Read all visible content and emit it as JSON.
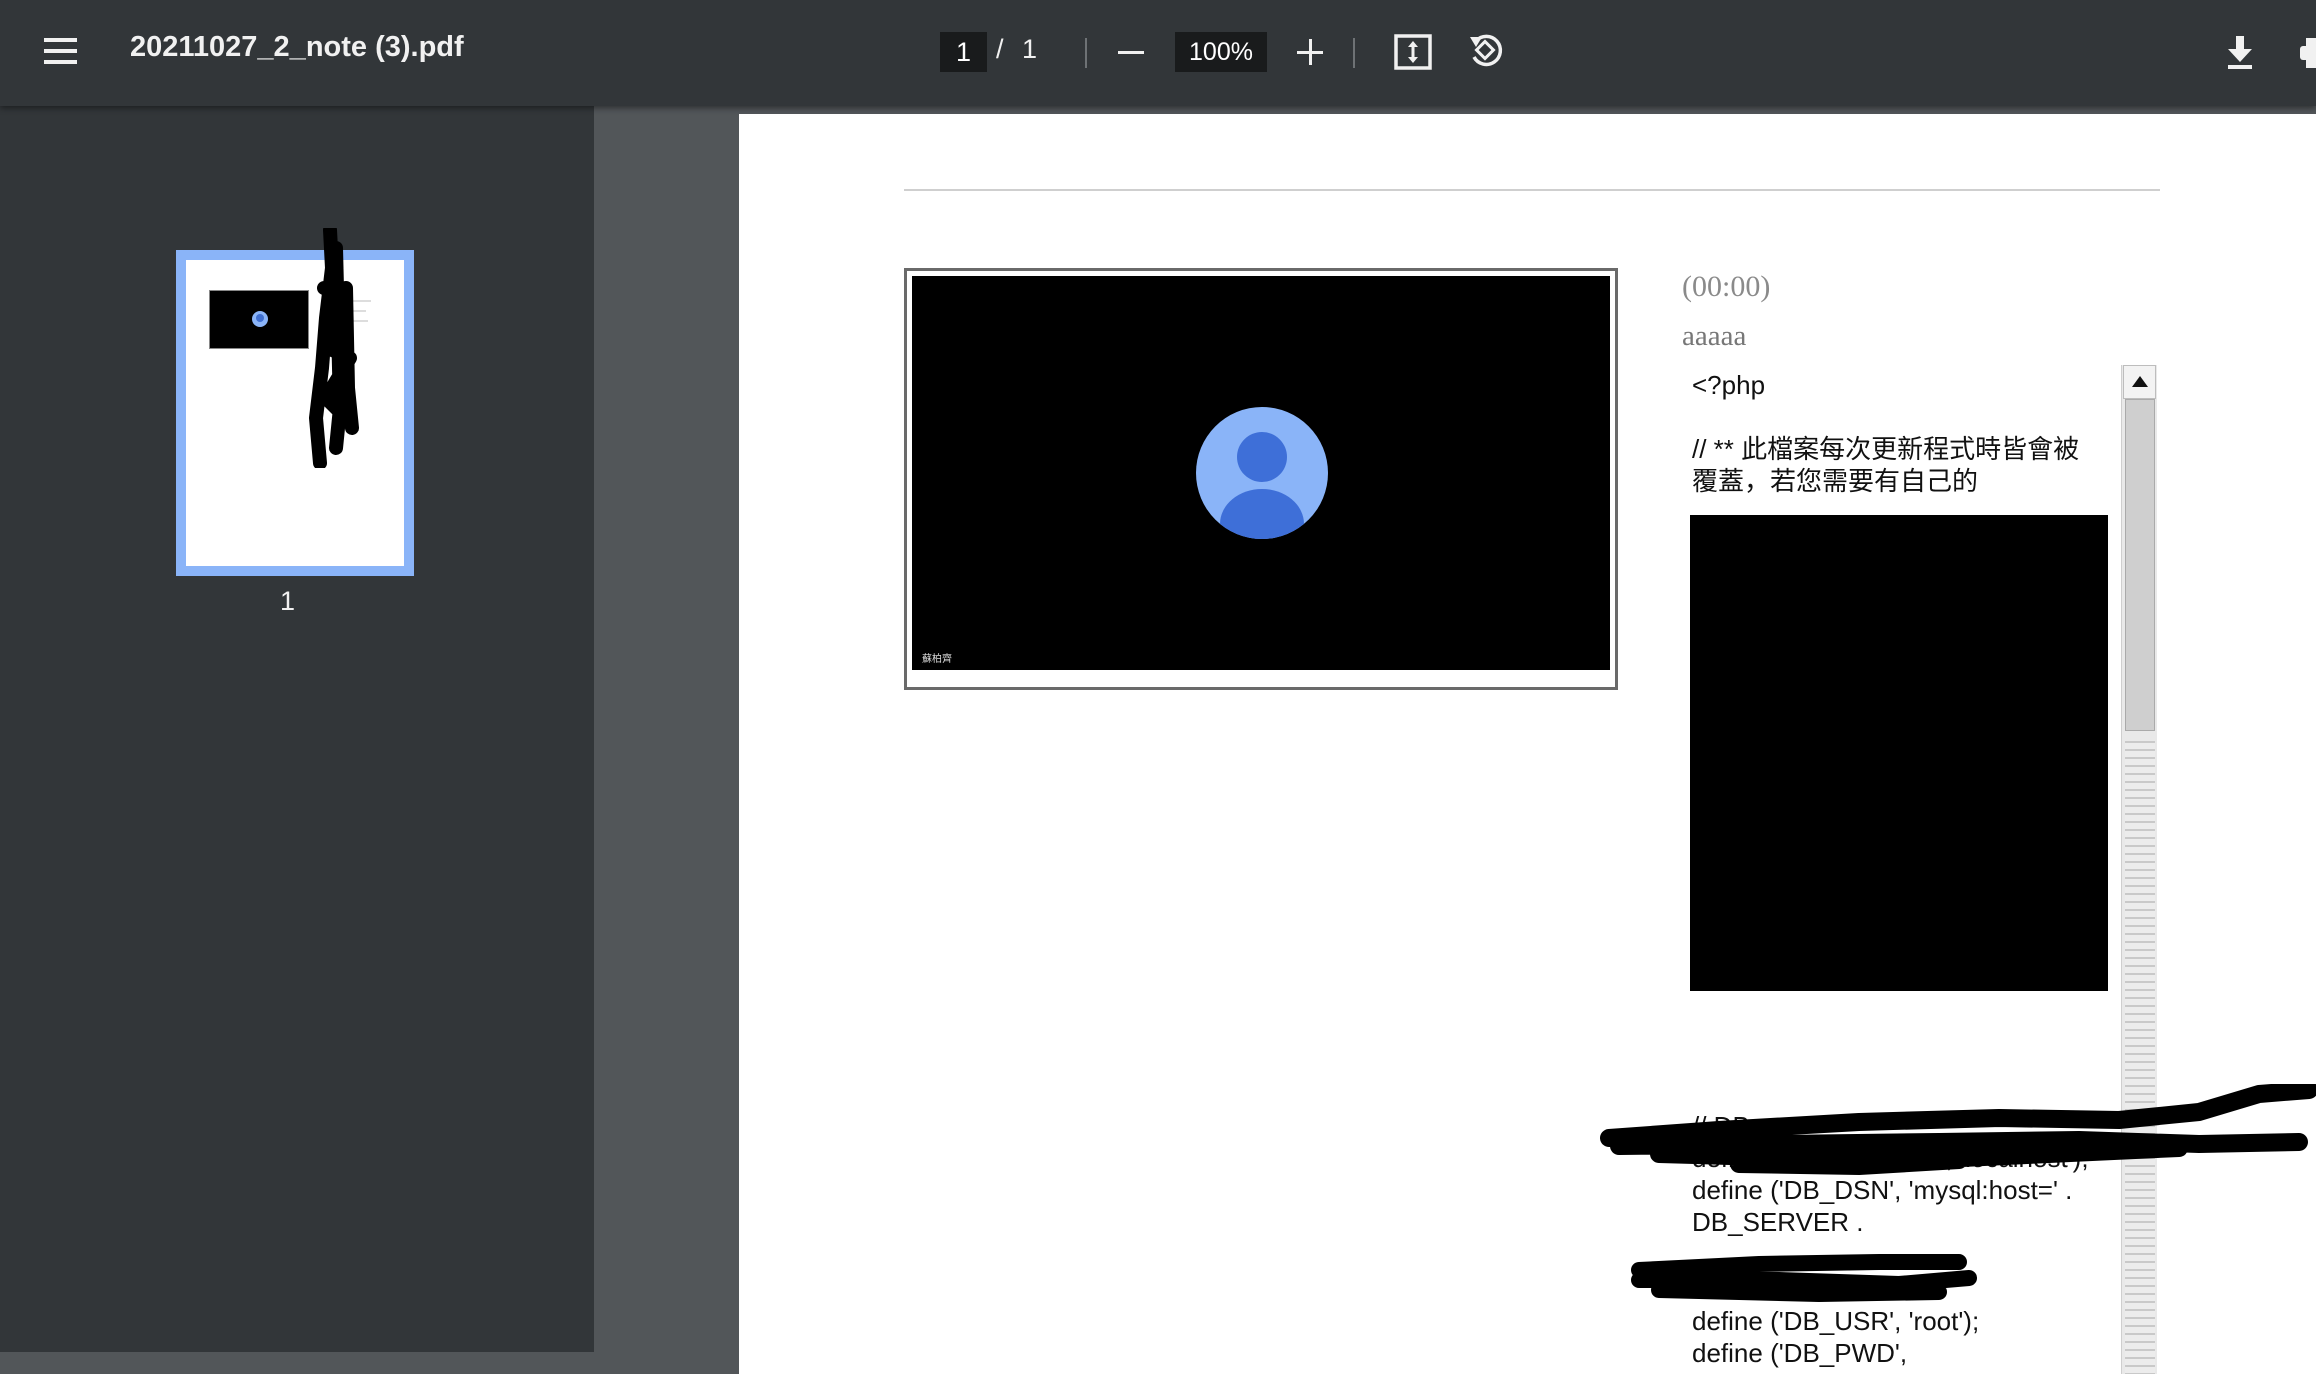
{
  "toolbar": {
    "file_name": "20211027_2_note (3).pdf",
    "current_page": "1",
    "page_separator": "/",
    "total_pages": "1",
    "zoom": "100%",
    "icons": [
      "menu-icon",
      "minus-icon",
      "plus-icon",
      "fit-page-icon",
      "rotate-icon",
      "download-icon",
      "print-icon"
    ]
  },
  "sidebar": {
    "thumbnail_label": "1"
  },
  "document": {
    "video": {
      "speaker_label": "蘇柏齊"
    },
    "timestamp": "(00:00)",
    "note": "aaaaa",
    "code": {
      "line1": "<?php",
      "comment": "// ** 此檔案每次更新程式時皆會被覆蓋，若您需要有自己的",
      "db_comment": "// DB",
      "db_server": "define ('DB_SERVER', 'localhost');",
      "db_dsn": "define ('DB_DSN', 'mysql:host=' .",
      "db_server_ref": "DB_SERVER .",
      "db_usr": "define ('DB_USR', 'root');",
      "db_pwd": "define ('DB_PWD',"
    }
  }
}
